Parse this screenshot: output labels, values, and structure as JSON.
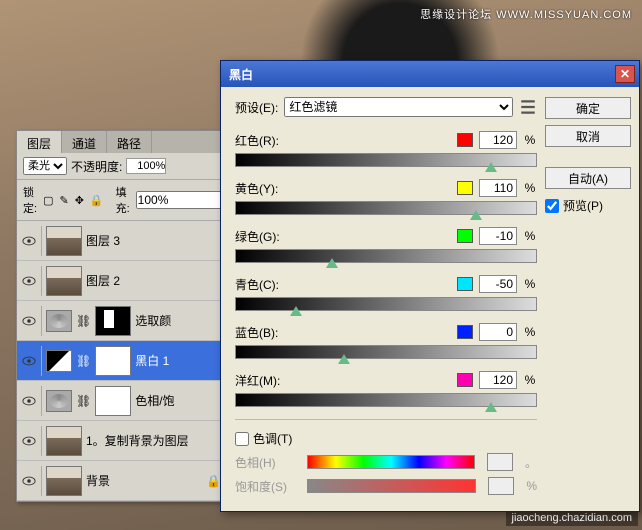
{
  "watermark": "思缘设计论坛 WWW.MISSYUAN.COM",
  "watermark2": "jiaocheng.chazidian.com",
  "layers_panel": {
    "tabs": [
      "图层",
      "通道",
      "路径"
    ],
    "active_tab": 0,
    "blend_label": "柔光",
    "opacity_label": "不透明度:",
    "opacity_value": "100%",
    "lock_label": "锁定:",
    "fill_label": "填充:",
    "fill_value": "100%",
    "rows": [
      {
        "name": "图层 3",
        "kind": "photo",
        "visible": true
      },
      {
        "name": "图层 2",
        "kind": "photo",
        "visible": true
      },
      {
        "name": "选取颜",
        "kind": "adj",
        "visible": true,
        "mask": "dark"
      },
      {
        "name": "黑白 1",
        "kind": "bwadj",
        "visible": true,
        "selected": true,
        "mask": "white"
      },
      {
        "name": "色相/饱",
        "kind": "adj",
        "visible": true,
        "mask": "white"
      },
      {
        "name": "1。复制背景为图层",
        "kind": "photo",
        "visible": true
      },
      {
        "name": "背景",
        "kind": "photo",
        "visible": true,
        "locked": true
      }
    ]
  },
  "dialog": {
    "title": "黑白",
    "preset_label": "预设(E):",
    "preset_value": "红色滤镜",
    "ok": "确定",
    "cancel": "取消",
    "auto": "自动(A)",
    "preview": "预览(P)",
    "preview_checked": true,
    "sliders": [
      {
        "label": "红色(R):",
        "swatch": "#ff0000",
        "value": "120",
        "pos": 85
      },
      {
        "label": "黄色(Y):",
        "swatch": "#ffff00",
        "value": "110",
        "pos": 80
      },
      {
        "label": "绿色(G):",
        "swatch": "#00ff00",
        "value": "-10",
        "pos": 32
      },
      {
        "label": "青色(C):",
        "swatch": "#00e5ff",
        "value": "-50",
        "pos": 20
      },
      {
        "label": "蓝色(B):",
        "swatch": "#0020ff",
        "value": "0",
        "pos": 36
      },
      {
        "label": "洋红(M):",
        "swatch": "#ff00b0",
        "value": "120",
        "pos": 85
      }
    ],
    "tint_label": "色调(T)",
    "tint_checked": false,
    "hue_label": "色相(H)",
    "hue_unit": "。",
    "sat_label": "饱和度(S)",
    "sat_unit": "%"
  }
}
